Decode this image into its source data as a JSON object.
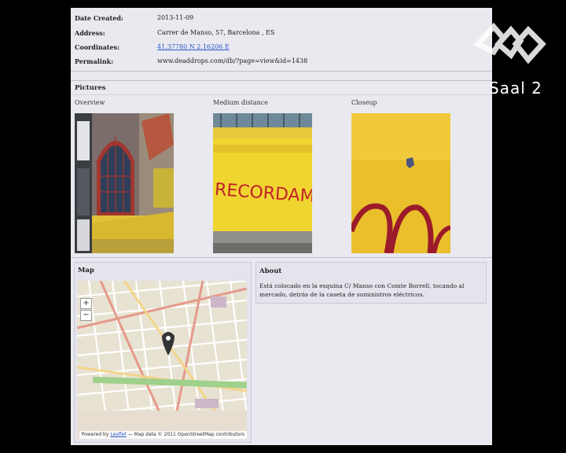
{
  "details": {
    "date_created_label": "Date Created:",
    "date_created_value": "2013-11-09",
    "address_label": "Address:",
    "address_value": "Carrer de Manso, 57, Barcelona , ES",
    "coordinates_label": "Coordinates:",
    "coordinates_value": "41.37780 N 2.16206 E",
    "permalink_label": "Permalink:",
    "permalink_value": "www.deaddrops.com/db/?page=view&id=1438"
  },
  "pictures": {
    "title": "Pictures",
    "items": [
      {
        "label": "Overview"
      },
      {
        "label": "Medium distance"
      },
      {
        "label": "Closeup"
      }
    ]
  },
  "map": {
    "title": "Map",
    "zoom_in": "+",
    "zoom_out": "−",
    "attribution_prefix": "Powered by",
    "attribution_link": "Leaflet",
    "attribution_suffix": "— Map data © 2011 OpenStreetMap contributors"
  },
  "about": {
    "title": "About",
    "text": "Está colocado en la esquina C/ Manso con Comte Borrell, tocando al mercado, detrás de la caseta de suministros eléctricos."
  },
  "overlay": {
    "channel": "Saal 2"
  }
}
